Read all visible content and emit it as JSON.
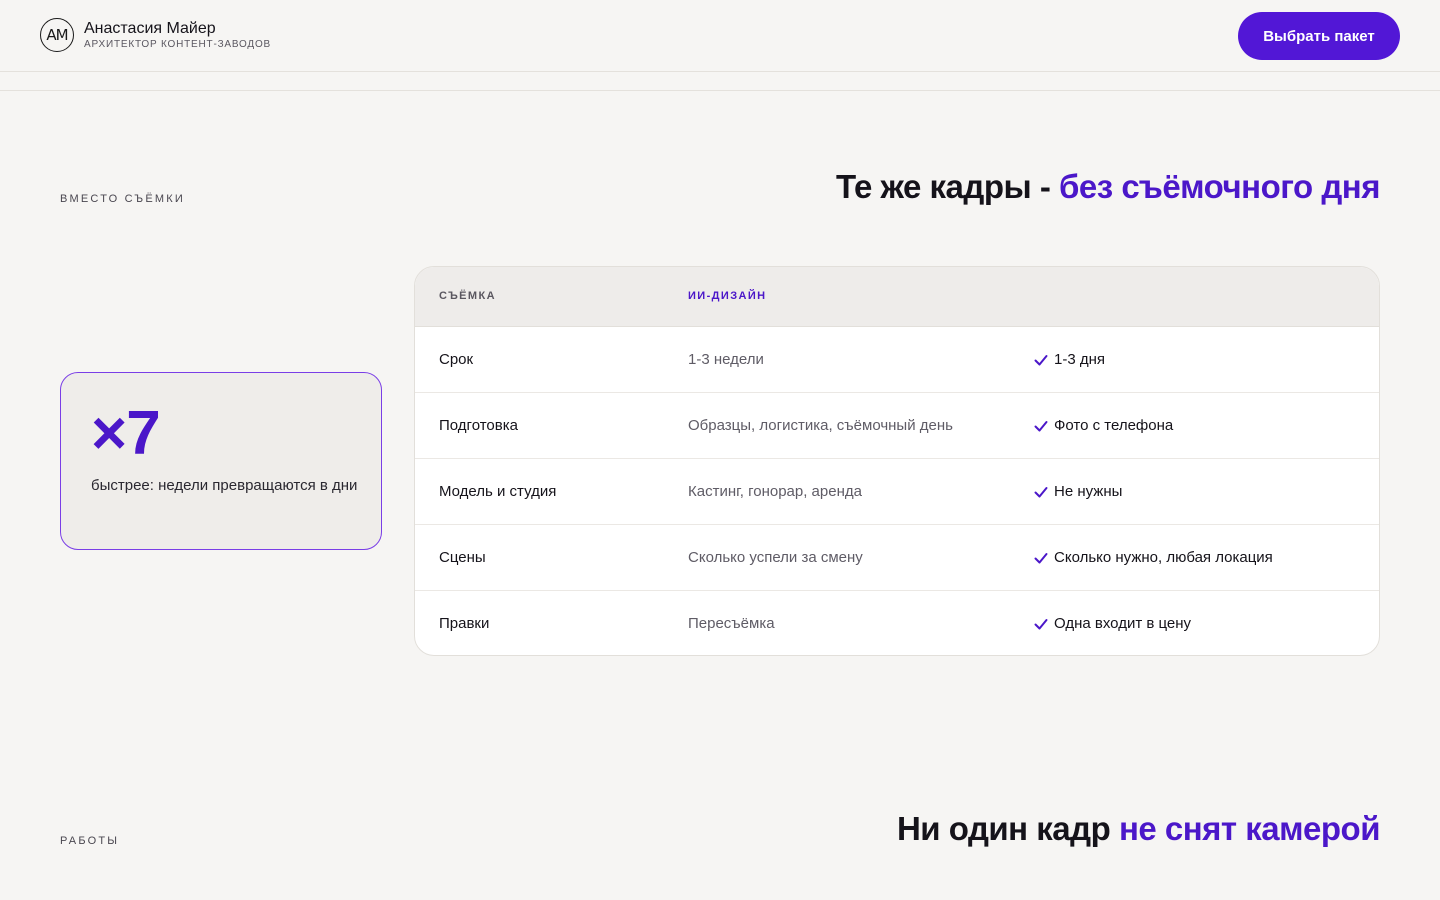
{
  "header": {
    "logo_text": "АМ",
    "name": "Анастасия Майер",
    "subtitle": "АРХИТЕКТОР КОНТЕНТ-ЗАВОДОВ",
    "cta_label": "Выбрать пакет"
  },
  "section1": {
    "eyebrow": "ВМЕСТО СЪЁМКИ",
    "title_main": "Те же кадры - ",
    "title_accent": "без съёмочного дня"
  },
  "stat": {
    "value": "×7",
    "text": "быстрее: недели превращаются в дни"
  },
  "table": {
    "headers": [
      "СЪЁМКА",
      "ИИ-ДИЗАЙН"
    ],
    "rows": [
      {
        "label": "Срок",
        "shoot": "1-3 недели",
        "ai": "1-3 дня"
      },
      {
        "label": "Подготовка",
        "shoot": "Образцы, логистика, съёмочный день",
        "ai": "Фото с телефона"
      },
      {
        "label": "Модель и студия",
        "shoot": "Кастинг, гонорар, аренда",
        "ai": "Не нужны"
      },
      {
        "label": "Сцены",
        "shoot": "Сколько успели за смену",
        "ai": "Сколько нужно, любая локация"
      },
      {
        "label": "Правки",
        "shoot": "Пересъёмка",
        "ai": "Одна входит в цену"
      }
    ]
  },
  "section2": {
    "eyebrow": "РАБОТЫ",
    "title_main": "Ни один кадр ",
    "title_accent": "не снят камерой"
  },
  "colors": {
    "accent": "#5217d6",
    "background": "#f6f5f3",
    "card_border": "#7a3ee6"
  },
  "icons": {
    "check": "check-icon"
  }
}
